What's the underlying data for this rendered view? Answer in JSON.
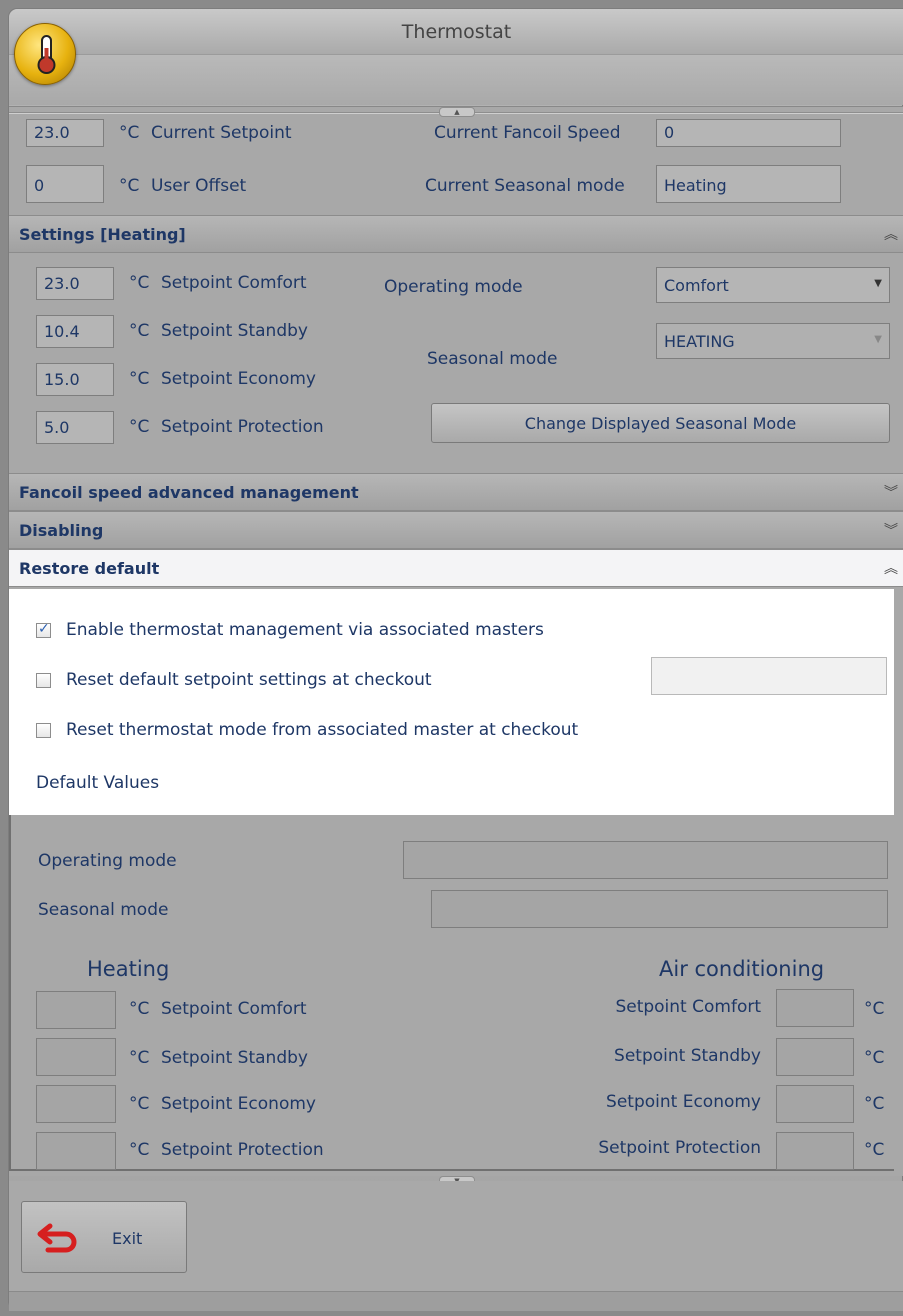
{
  "window": {
    "title": "Thermostat"
  },
  "status": {
    "setpoint_value": "23.0",
    "setpoint_unit": "°C",
    "setpoint_label": "Current Setpoint",
    "offset_value": "0",
    "offset_unit": "°C",
    "offset_label": "User Offset",
    "fancoil_label": "Current Fancoil Speed",
    "fancoil_value": "0",
    "seasonal_label": "Current Seasonal mode",
    "seasonal_value": "Heating"
  },
  "settings": {
    "header": "Settings [Heating]",
    "unit": "°C",
    "rows": [
      {
        "value": "23.0",
        "label": "Setpoint Comfort"
      },
      {
        "value": "10.4",
        "label": "Setpoint Standby"
      },
      {
        "value": "15.0",
        "label": "Setpoint Economy"
      },
      {
        "value": "5.0",
        "label": "Setpoint Protection"
      }
    ],
    "operating_mode_label": "Operating mode",
    "operating_mode_value": "Comfort",
    "seasonal_mode_label": "Seasonal mode",
    "seasonal_mode_value": "HEATING",
    "change_button": "Change Displayed Seasonal Mode"
  },
  "sections": {
    "fancoil": "Fancoil speed advanced management",
    "disabling": "Disabling",
    "restore": "Restore default"
  },
  "restore": {
    "enable_label": "Enable thermostat management via associated masters",
    "enable_checked": true,
    "reset_setpoint_label": "Reset default setpoint settings at checkout",
    "reset_setpoint_checked": false,
    "reset_mode_label": "Reset thermostat mode from associated master at checkout",
    "reset_mode_checked": false,
    "default_values_label": "Default Values"
  },
  "defaults": {
    "operating_mode_label": "Operating mode",
    "seasonal_mode_label": "Seasonal mode",
    "heating_title": "Heating",
    "ac_title": "Air conditioning",
    "unit": "°C",
    "labels": [
      "Setpoint Comfort",
      "Setpoint Standby",
      "Setpoint Economy",
      "Setpoint Protection"
    ]
  },
  "footer": {
    "exit_label": "Exit"
  },
  "colors": {
    "text": "#1e3766",
    "background": "#a8a8a8",
    "exit_icon": "#d61f1f"
  }
}
